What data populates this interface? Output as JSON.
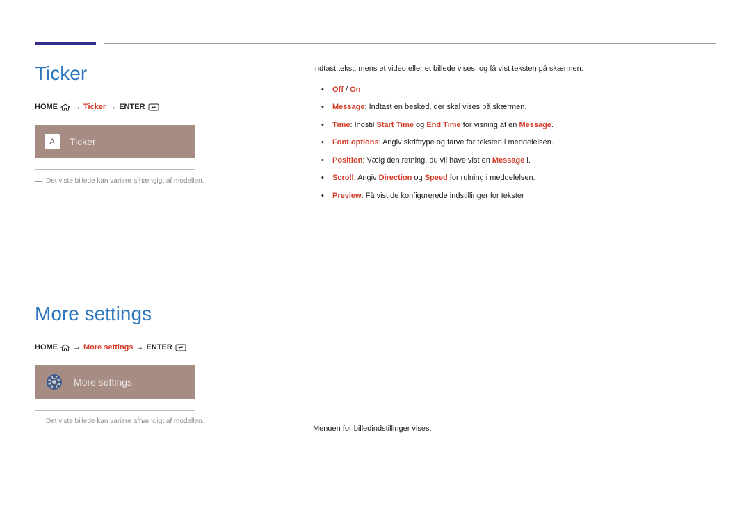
{
  "sections": {
    "ticker": {
      "heading": "Ticker",
      "breadcrumb": {
        "home": "HOME",
        "arrow1": "→",
        "item": "Ticker",
        "arrow2": "→",
        "enter": "ENTER"
      },
      "tile": {
        "iconLabel": "A",
        "label": "Ticker"
      },
      "note": "Det viste billede kan variere afhængigt af modellen.",
      "intro": "Indtast tekst, mens et video eller et billede vises, og få vist teksten på skærmen.",
      "bullets": [
        {
          "k1": "Off",
          "sep": " / ",
          "k2": "On"
        },
        {
          "k": "Message",
          "text": ": Indtast en besked, der skal vises på skærmen."
        },
        {
          "k": "Time",
          "text1": ": Indstil ",
          "k2": "Start Time",
          "text2": " og ",
          "k3": "End Time",
          "text3": " for visning af en ",
          "k4": "Message",
          "text4": "."
        },
        {
          "k": "Font options",
          "text": ": Angiv skrifttype og farve for teksten i meddelelsen."
        },
        {
          "k": "Position",
          "text1": ":  Vælg den retning, du vil have vist en ",
          "k2": "Message",
          "text2": " i."
        },
        {
          "k": "Scroll",
          "text1": ": Angiv ",
          "k2": "Direction",
          "text2": " og ",
          "k3": "Speed",
          "text3": " for rulning i meddelelsen."
        },
        {
          "k": "Preview",
          "text": ": Få vist de konfigurerede indstillinger for tekster"
        }
      ]
    },
    "moreSettings": {
      "heading": "More settings",
      "breadcrumb": {
        "home": "HOME",
        "arrow1": "→",
        "item": "More settings",
        "arrow2": "→",
        "enter": "ENTER"
      },
      "tile": {
        "label": "More settings"
      },
      "note": "Det viste billede kan variere afhængigt af modellen.",
      "intro": "Menuen for billedindstillinger vises."
    }
  }
}
